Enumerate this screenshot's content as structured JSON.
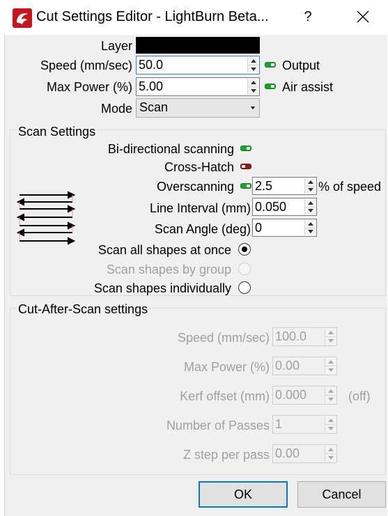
{
  "window": {
    "title": "Cut Settings Editor - LightBurn Beta...",
    "help_label": "?",
    "app_icon": "lightburn-logo-icon",
    "close_icon": "close-icon"
  },
  "layer": {
    "label": "Layer",
    "color": "#000000"
  },
  "speed": {
    "label": "Speed (mm/sec)",
    "value": "50.0"
  },
  "max_power": {
    "label": "Max Power (%)",
    "value": "5.00"
  },
  "output": {
    "label": "Output",
    "state": "on"
  },
  "air_assist": {
    "label": "Air assist",
    "state": "on"
  },
  "mode": {
    "label": "Mode",
    "value": "Scan"
  },
  "scan_settings": {
    "title": "Scan Settings",
    "bidirectional": {
      "label": "Bi-directional scanning",
      "state": "on"
    },
    "cross_hatch": {
      "label": "Cross-Hatch",
      "state": "off"
    },
    "overscanning": {
      "label": "Overscanning",
      "state": "on",
      "value": "2.5",
      "unit": "% of speed"
    },
    "line_interval": {
      "label": "Line Interval (mm)",
      "value": "0.050"
    },
    "scan_angle": {
      "label": "Scan Angle (deg)",
      "value": "0"
    },
    "illustration_icon": "scan-lines-icon",
    "scan_options": [
      {
        "label": "Scan all shapes at once",
        "selected": true,
        "enabled": true
      },
      {
        "label": "Scan shapes by group",
        "selected": false,
        "enabled": false
      },
      {
        "label": "Scan shapes individually",
        "selected": false,
        "enabled": true
      }
    ]
  },
  "cut_after_scan": {
    "title": "Cut-After-Scan settings",
    "speed": {
      "label": "Speed (mm/sec)",
      "value": "100.0"
    },
    "max_power": {
      "label": "Max Power (%)",
      "value": "0.00"
    },
    "kerf_offset": {
      "label": "Kerf offset (mm)",
      "value": "0.000",
      "suffix": "(off)"
    },
    "passes": {
      "label": "Number of Passes",
      "value": "1"
    },
    "z_step": {
      "label": "Z step per pass",
      "value": "0.00"
    }
  },
  "buttons": {
    "ok": "OK",
    "cancel": "Cancel"
  },
  "colors": {
    "toggle_on": "#16a32a",
    "toggle_off": "#8e1b1b",
    "focus_border": "#3c7fd6",
    "default_button": "#0078d7"
  }
}
